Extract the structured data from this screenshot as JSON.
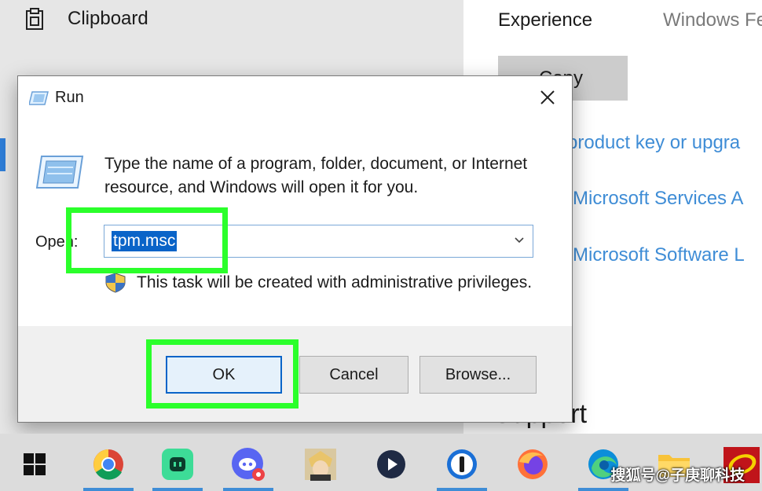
{
  "settings": {
    "clipboard_label": "Clipboard",
    "tabs": [
      {
        "label": "Experience"
      },
      {
        "label": "Windows Fe"
      }
    ],
    "copy_label": "Copy",
    "links": [
      {
        "label": "product key or upgra"
      },
      {
        "label": "e Microsoft Services A"
      },
      {
        "label": "e Microsoft Software L"
      }
    ],
    "support_label": "Support"
  },
  "dialog": {
    "title": "Run",
    "description": "Type the name of a program, folder, document, or Internet resource, and Windows will open it for you.",
    "open_label": "Open:",
    "open_value": "tpm.msc",
    "admin_note": "This task will be created with administrative privileges.",
    "ok_label": "OK",
    "cancel_label": "Cancel",
    "browse_label": "Browse..."
  },
  "taskbar": {
    "items": [
      {
        "icon": "windows-start-icon"
      },
      {
        "icon": "chrome-icon",
        "active": true
      },
      {
        "icon": "remote-app-icon",
        "active": true
      },
      {
        "icon": "discord-icon",
        "active": true
      },
      {
        "icon": "game-character-icon"
      },
      {
        "icon": "media-player-icon"
      },
      {
        "icon": "password-manager-icon",
        "active": true
      },
      {
        "icon": "firefox-icon"
      },
      {
        "icon": "edge-icon",
        "active": true
      },
      {
        "icon": "file-explorer-icon"
      },
      {
        "icon": "uno-game-icon"
      }
    ],
    "watermark": "搜狐号@子庚聊科技"
  },
  "colors": {
    "highlight": "#2bff2b",
    "accent": "#0a64c8",
    "link": "#3f8dd6"
  }
}
